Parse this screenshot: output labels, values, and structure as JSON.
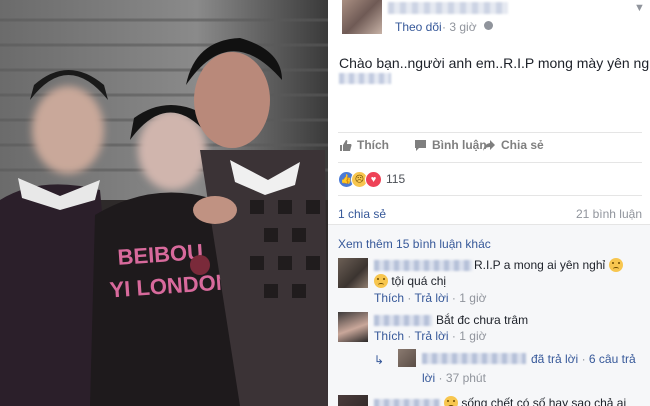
{
  "photo": {
    "description_icon": "photo-of-three-people",
    "shirt_text_line1": "BEIBOU",
    "shirt_text_line2": "YI LONDON"
  },
  "post": {
    "follow_label": "Theo dõi",
    "separator": "·",
    "time": "3 giờ",
    "body": "Chào bạn..người anh em..R.I.P mong mày yên nghỉ!",
    "actions": {
      "like": "Thích",
      "comment": "Bình luận",
      "share": "Chia sẻ"
    },
    "reaction_count": "115",
    "share_count": "1 chia sẻ",
    "comment_count": "21 bình luận"
  },
  "comments": {
    "see_more": "Xem thêm 15 bình luận khác",
    "items": [
      {
        "text_line1": "R.I.P a mong ai yên nghỉ",
        "text_line2": "tội quá chị",
        "like": "Thích",
        "reply": "Trả lời",
        "dot": "·",
        "time": "1 giờ"
      },
      {
        "text_line1": "Bắt đc chưa trâm",
        "like": "Thích",
        "reply": "Trả lời",
        "dot": "·",
        "time": "1 giờ"
      },
      {
        "reply_arrow": "↳",
        "replied_text": "đã trả lời",
        "dot": "·",
        "reply_count": "6 câu trả",
        "reply_count_line2": "lời",
        "time": "37 phút"
      },
      {
        "text_line1": "sống chết có số hay sao chả ai"
      }
    ]
  },
  "icons": {
    "globe": "globe-icon",
    "caret": "chevron-down-icon",
    "like": "thumbs-up-icon",
    "comment": "comment-bubble-icon",
    "share": "share-arrow-icon"
  },
  "colors": {
    "link": "#365899",
    "meta": "#90949c",
    "like_reaction": "#4b7bd6",
    "love_reaction": "#ee4257",
    "sad_reaction": "#f7c64f"
  }
}
